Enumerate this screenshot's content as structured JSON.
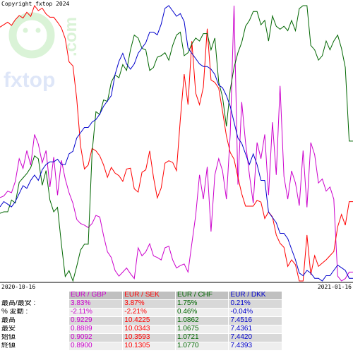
{
  "copyright": "Copyright fxtop 2024",
  "watermark": {
    "brand": "fxtop",
    "tld": ".com"
  },
  "x_start_label": "2020-10-16",
  "x_end_label": "2021-01-16",
  "chart_data": {
    "type": "line",
    "series": [
      {
        "name": "EUR / GBP",
        "color": "#cc00cc",
        "values": [
          0.8992,
          0.8994,
          0.9,
          0.8998,
          0.9012,
          0.904,
          0.9028,
          0.905,
          0.9032,
          0.907,
          0.9058,
          0.9035,
          0.905,
          0.9005,
          0.9042,
          0.8995,
          0.9038,
          0.9015,
          0.8998,
          0.8985,
          0.8965,
          0.896,
          0.8958,
          0.8955,
          0.896,
          0.897,
          0.8968,
          0.8945,
          0.8925,
          0.8918,
          0.8902,
          0.8895,
          0.89,
          0.8905,
          0.8898,
          0.8892,
          0.893,
          0.892,
          0.8925,
          0.8935,
          0.892,
          0.8918,
          0.8915,
          0.893,
          0.8932,
          0.8915,
          0.8905,
          0.8908,
          0.891,
          0.89,
          0.8935,
          0.897,
          0.902,
          0.899,
          0.903,
          0.895,
          0.902,
          0.904,
          0.9025,
          0.899,
          0.907,
          0.9229,
          0.9008,
          0.911,
          0.906,
          0.902,
          0.8985,
          0.906,
          0.904,
          0.907,
          0.8995,
          0.9085,
          0.902,
          0.913,
          0.9018,
          0.899,
          0.9025,
          0.901,
          0.8982,
          0.905,
          0.898,
          0.906,
          0.9045,
          0.901,
          0.9015,
          0.9,
          0.9005,
          0.899,
          0.8895,
          0.8889,
          0.8892,
          0.89,
          0.89
        ],
        "stats": {
          "range": "3.83%",
          "change": "-2.11%",
          "max": "0.9229",
          "min": "0.8889",
          "start": "0.9092",
          "end": "0.8900"
        }
      },
      {
        "name": "EUR / SEK",
        "color": "#ff0000",
        "values": [
          10.342,
          10.345,
          10.348,
          10.344,
          10.351,
          10.356,
          10.353,
          10.36,
          10.355,
          10.368,
          10.362,
          10.365,
          10.358,
          10.354,
          10.354,
          10.348,
          10.341,
          10.328,
          10.3,
          10.295,
          10.255,
          10.198,
          10.17,
          10.175,
          10.195,
          10.192,
          10.186,
          10.175,
          10.16,
          10.172,
          10.165,
          10.162,
          10.155,
          10.17,
          10.171,
          10.146,
          10.142,
          10.166,
          10.169,
          10.192,
          10.16,
          10.135,
          10.147,
          10.177,
          10.18,
          10.178,
          10.168,
          10.23,
          10.285,
          10.248,
          10.325,
          10.262,
          10.248,
          10.269,
          10.34,
          10.278,
          10.275,
          10.268,
          10.24,
          10.21,
          10.19,
          10.182,
          10.16,
          10.14,
          10.125,
          10.125,
          10.125,
          10.132,
          10.13,
          10.11,
          10.118,
          10.112,
          10.09,
          10.08,
          10.075,
          10.052,
          10.06,
          10.054,
          10.0343,
          10.0343,
          10.09,
          10.042,
          10.065,
          10.052,
          10.056,
          10.06,
          10.065,
          10.07,
          10.1,
          10.115,
          10.102,
          10.1305,
          10.1305
        ],
        "stats": {
          "range": "3.87%",
          "change": "-2.21%",
          "max": "10.4225",
          "min": "10.0343",
          "start": "10.3593",
          "end": "10.1305"
        }
      },
      {
        "name": "EUR / CHF",
        "color": "#006600",
        "values": [
          1.0721,
          1.0722,
          1.0722,
          1.073,
          1.0728,
          1.0742,
          1.0745,
          1.0748,
          1.0752,
          1.076,
          1.0758,
          1.074,
          1.075,
          1.073,
          1.0722,
          1.0725,
          1.07,
          1.0678,
          1.0682,
          1.0675,
          1.0685,
          1.0696,
          1.07,
          1.07,
          1.0762,
          1.079,
          1.0788,
          1.0798,
          1.0797,
          1.081,
          1.0815,
          1.0813,
          1.0822,
          1.0818,
          1.0832,
          1.0842,
          1.084,
          1.0833,
          1.0832,
          1.0818,
          1.082,
          1.0827,
          1.0828,
          1.083,
          1.0825,
          1.0835,
          1.0842,
          1.0844,
          1.0828,
          1.083,
          1.0836,
          1.084,
          1.0838,
          1.0843,
          1.0843,
          1.0832,
          1.084,
          1.081,
          1.08,
          1.078,
          1.0805,
          1.082,
          1.083,
          1.0837,
          1.0848,
          1.0852,
          1.0858,
          1.0858,
          1.0849,
          1.0852,
          1.0838,
          1.0855,
          1.0848,
          1.0846,
          1.0848,
          1.0845,
          1.0852,
          1.0845,
          1.086,
          1.0862,
          1.0862,
          1.0835,
          1.0832,
          1.0825,
          1.0828,
          1.0838,
          1.0832,
          1.0838,
          1.0842,
          1.0833,
          1.082,
          1.077,
          1.077
        ],
        "stats": {
          "range": "1.75%",
          "change": "0.46%",
          "max": "1.0862",
          "min": "1.0675",
          "start": "1.0721",
          "end": "1.0770"
        }
      },
      {
        "name": "EUR / DKK",
        "color": "#0000cc",
        "values": [
          7.442,
          7.4422,
          7.4421,
          7.442,
          7.4422,
          7.4425,
          7.4428,
          7.4427,
          7.443,
          7.4432,
          7.443,
          7.4434,
          7.4436,
          7.4437,
          7.4437,
          7.4438,
          7.4436,
          7.4436,
          7.444,
          7.4441,
          7.4446,
          7.4448,
          7.445,
          7.445,
          7.4452,
          7.4453,
          7.4455,
          7.4458,
          7.446,
          7.4462,
          7.447,
          7.4475,
          7.4478,
          7.4474,
          7.4472,
          7.4474,
          7.4478,
          7.448,
          7.4482,
          7.4486,
          7.4486,
          7.4485,
          7.4489,
          7.4495,
          7.4496,
          7.4494,
          7.4492,
          7.4493,
          7.449,
          7.448,
          7.4478,
          7.4476,
          7.4474,
          7.4473,
          7.4473,
          7.4472,
          7.447,
          7.4466,
          7.4465,
          7.4462,
          7.4458,
          7.4452,
          7.4446,
          7.4444,
          7.444,
          7.4436,
          7.444,
          7.4436,
          7.443,
          7.443,
          7.4418,
          7.4416,
          7.4414,
          7.441,
          7.441,
          7.4408,
          7.4404,
          7.44,
          7.4395,
          7.4394,
          7.4396,
          7.4395,
          7.4393,
          7.4393,
          7.4392,
          7.4394,
          7.4394,
          7.4396,
          7.4398,
          7.4397,
          7.4396,
          7.4393,
          7.4393
        ],
        "stats": {
          "range": "0.21%",
          "change": "-0.04%",
          "max": "7.4516",
          "min": "7.4361",
          "start": "7.4420",
          "end": "7.4393"
        }
      }
    ],
    "row_labels": {
      "range": "最高/最安 :",
      "change": "% 変動 :",
      "max": "最高",
      "min": "最安",
      "start": "始値",
      "end": "終値"
    }
  }
}
